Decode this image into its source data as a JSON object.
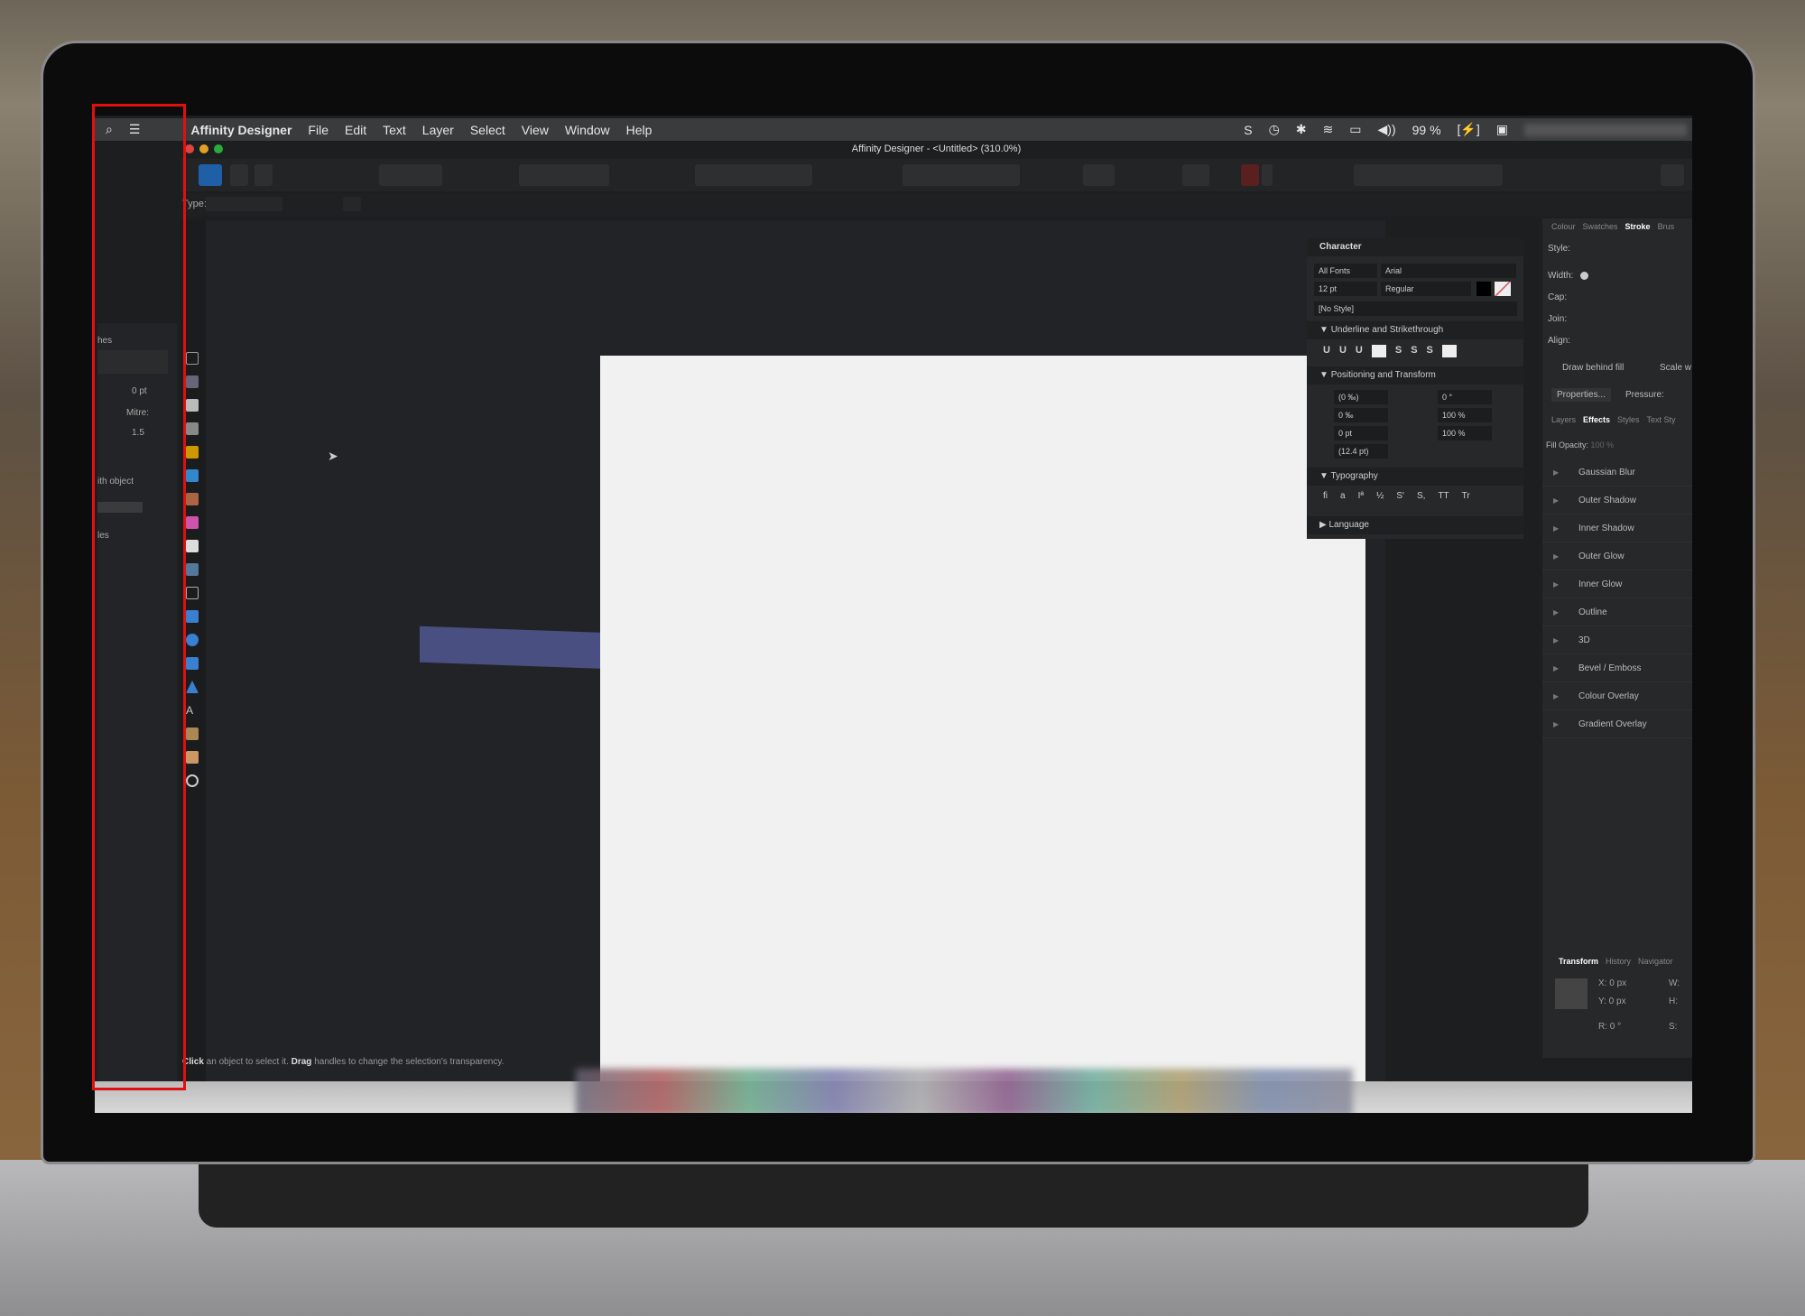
{
  "menubar": {
    "app_name": "Affinity Designer",
    "items": [
      "File",
      "Edit",
      "Text",
      "Layer",
      "Select",
      "View",
      "Window",
      "Help"
    ],
    "battery": "99 %",
    "status_icons": [
      "skype-icon",
      "time-machine-icon",
      "bluetooth-icon",
      "wifi-icon",
      "airplay-icon",
      "volume-icon",
      "battery-icon",
      "display-icon"
    ]
  },
  "window": {
    "title": "Affinity Designer - <Untitled> (310.0%)"
  },
  "context_toolbar": {
    "type_label": "Type:"
  },
  "left_panel": {
    "labels": [
      "hes",
      "0 pt",
      "Mitre:",
      "1.5",
      "ith object",
      "les"
    ]
  },
  "character_panel": {
    "title": "Character",
    "font_collection": "All Fonts",
    "font_family": "Arial",
    "font_size": "12 pt",
    "font_style": "Regular",
    "paragraph_style": "[No Style]",
    "sections": {
      "underline": "Underline and Strikethrough",
      "positioning": "Positioning and Transform",
      "typography": "Typography",
      "language": "Language"
    },
    "underline_buttons": [
      "U",
      "U",
      "U",
      "S",
      "S",
      "S"
    ],
    "positioning": {
      "kerning": "(0 ‰)",
      "tracking": "0 ‰",
      "baseline": "0 pt",
      "leading": "(12.4 pt)",
      "shear": "0 °",
      "vertical_scale": "100 %",
      "horizontal_scale": "100 %"
    },
    "typography_buttons": [
      "fi",
      "a",
      "Iª",
      "½",
      "S'",
      "S,",
      "TT",
      "Tr"
    ]
  },
  "stroke_panel": {
    "tabs": [
      "Colour",
      "Swatches",
      "Stroke",
      "Brus"
    ],
    "active_tab": "Stroke",
    "style_label": "Style:",
    "width_label": "Width:",
    "cap_label": "Cap:",
    "join_label": "Join:",
    "align_label": "Align:",
    "draw_behind_fill": "Draw behind fill",
    "scale_with": "Scale w",
    "properties_button": "Properties...",
    "pressure_label": "Pressure:"
  },
  "effects_panel": {
    "tabs": [
      "Layers",
      "Effects",
      "Styles",
      "Text Sty"
    ],
    "active_tab": "Effects",
    "fill_opacity_label": "Fill Opacity:",
    "fill_opacity_value": "100 %",
    "effects": [
      "Gaussian Blur",
      "Outer Shadow",
      "Inner Shadow",
      "Outer Glow",
      "Inner Glow",
      "Outline",
      "3D",
      "Bevel / Emboss",
      "Colour Overlay",
      "Gradient Overlay"
    ]
  },
  "transform_panel": {
    "tabs": [
      "Transform",
      "History",
      "Navigator"
    ],
    "active_tab": "Transform",
    "x": "X: 0 px",
    "y": "Y: 0 px",
    "r": "R: 0 °",
    "w": "W:",
    "h": "H:",
    "s": "S:"
  },
  "status_bar": {
    "click": "Click",
    "text1": " an object to select it. ",
    "drag": "Drag",
    "text2": " handles to change the selection's transparency."
  },
  "colors": {
    "highlight_box": "#e01010",
    "accent": "#3d7fd6"
  }
}
